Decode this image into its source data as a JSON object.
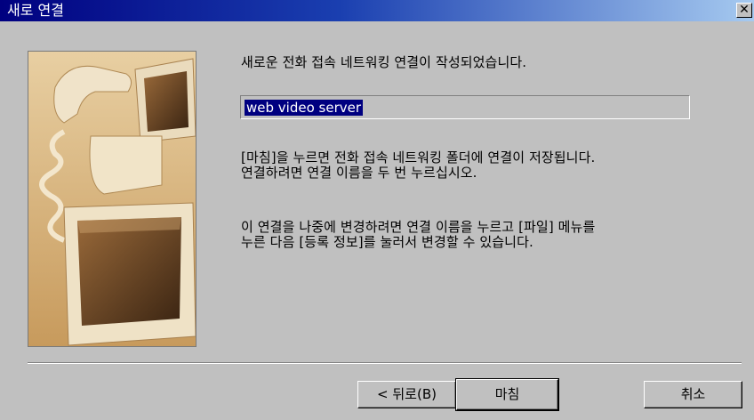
{
  "window": {
    "title": "새로 연결",
    "close_symbol": "✕"
  },
  "content": {
    "heading": "새로운 전화 접속 네트워킹 연결이 작성되었습니다.",
    "connection_name": "web video server",
    "info_paragraph_1": "[마침]을 누르면 전화 접속 네트워킹 폴더에 연결이 저장됩니다.\n연결하려면 연결 이름을 두 번 누르십시오.",
    "info_paragraph_2": "이 연결을 나중에 변경하려면 연결 이름을 누르고 [파일] 메뉴를\n누른 다음 [등록 정보]를 눌러서 변경할 수 있습니다."
  },
  "buttons": {
    "back": "< 뒤로(B)",
    "finish": "마침",
    "cancel": "취소"
  },
  "illustration": {
    "description_icon": "computer-phone-illustration"
  },
  "colors": {
    "titlebar_start": "#000080",
    "titlebar_end": "#a6caf0",
    "face": "#c0c0c0",
    "selection": "#000080"
  }
}
